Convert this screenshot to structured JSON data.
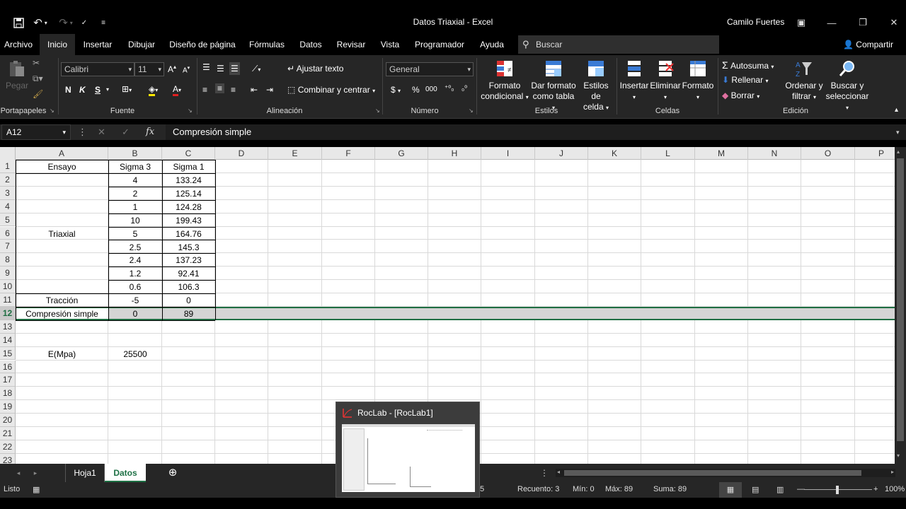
{
  "window": {
    "title": "Datos Triaxial  -  Excel",
    "user": "Camilo Fuertes"
  },
  "tabs": [
    "Archivo",
    "Inicio",
    "Insertar",
    "Dibujar",
    "Diseño de página",
    "Fórmulas",
    "Datos",
    "Revisar",
    "Vista",
    "Programador",
    "Ayuda"
  ],
  "search": {
    "label": "Buscar"
  },
  "share": {
    "label": "Compartir"
  },
  "ribbon": {
    "clipboard": {
      "paste": "Pegar",
      "group": "Portapapeles"
    },
    "font": {
      "name": "Calibri",
      "size": "11",
      "bold": "N",
      "italic": "K",
      "underline": "S",
      "group": "Fuente"
    },
    "alignment": {
      "wrap": "Ajustar texto",
      "merge": "Combinar y centrar",
      "group": "Alineación"
    },
    "number": {
      "format": "General",
      "currency": "$",
      "percent": "%",
      "thousands": "000",
      "group": "Número"
    },
    "styles": {
      "conditional": [
        "Formato",
        "condicional"
      ],
      "table": [
        "Dar formato",
        "como tabla"
      ],
      "cell": [
        "Estilos de",
        "celda"
      ],
      "group": "Estilos"
    },
    "cells": {
      "insert": "Insertar",
      "delete": "Eliminar",
      "format": "Formato",
      "group": "Celdas"
    },
    "editing": {
      "autosum": "Autosuma",
      "fill": "Rellenar",
      "clear": "Borrar",
      "sort": [
        "Ordenar y",
        "filtrar"
      ],
      "find": [
        "Buscar y",
        "seleccionar"
      ],
      "group": "Edición"
    }
  },
  "formula_bar": {
    "cell_ref": "A12",
    "content": "Compresión simple"
  },
  "columns": [
    "A",
    "B",
    "C",
    "D",
    "E",
    "F",
    "G",
    "H",
    "I",
    "J",
    "K",
    "L",
    "M",
    "N",
    "O",
    "P"
  ],
  "rows": [
    "1",
    "2",
    "3",
    "4",
    "5",
    "6",
    "7",
    "8",
    "9",
    "10",
    "11",
    "12",
    "13",
    "14",
    "15",
    "16",
    "17",
    "18",
    "19",
    "20",
    "21",
    "22",
    "23"
  ],
  "sheet": {
    "headers": {
      "a": "Ensayo",
      "b": "Sigma 3",
      "c": "Sigma 1"
    },
    "triaxial_label": "Triaxial",
    "triaxial": [
      {
        "s3": "4",
        "s1": "133.24"
      },
      {
        "s3": "2",
        "s1": "125.14"
      },
      {
        "s3": "1",
        "s1": "124.28"
      },
      {
        "s3": "10",
        "s1": "199.43"
      },
      {
        "s3": "5",
        "s1": "164.76"
      },
      {
        "s3": "2.5",
        "s1": "145.3"
      },
      {
        "s3": "2.4",
        "s1": "137.23"
      },
      {
        "s3": "1.2",
        "s1": "92.41"
      },
      {
        "s3": "0.6",
        "s1": "106.3"
      }
    ],
    "traccion": {
      "label": "Tracción",
      "s3": "-5",
      "s1": "0"
    },
    "compresion": {
      "label": "Compresión simple",
      "s3": "0",
      "s1": "89"
    },
    "modulus": {
      "label": "E(Mpa)",
      "value": "25500"
    }
  },
  "sheet_tabs": [
    "Hoja1",
    "Datos"
  ],
  "status": {
    "mode": "Listo",
    "partial": "5",
    "count": "Recuento: 3",
    "min": "Mín: 0",
    "max": "Máx: 89",
    "sum": "Suma: 89",
    "zoom": "100%"
  },
  "taskbar_preview": {
    "title": "RocLab - [RocLab1]"
  }
}
